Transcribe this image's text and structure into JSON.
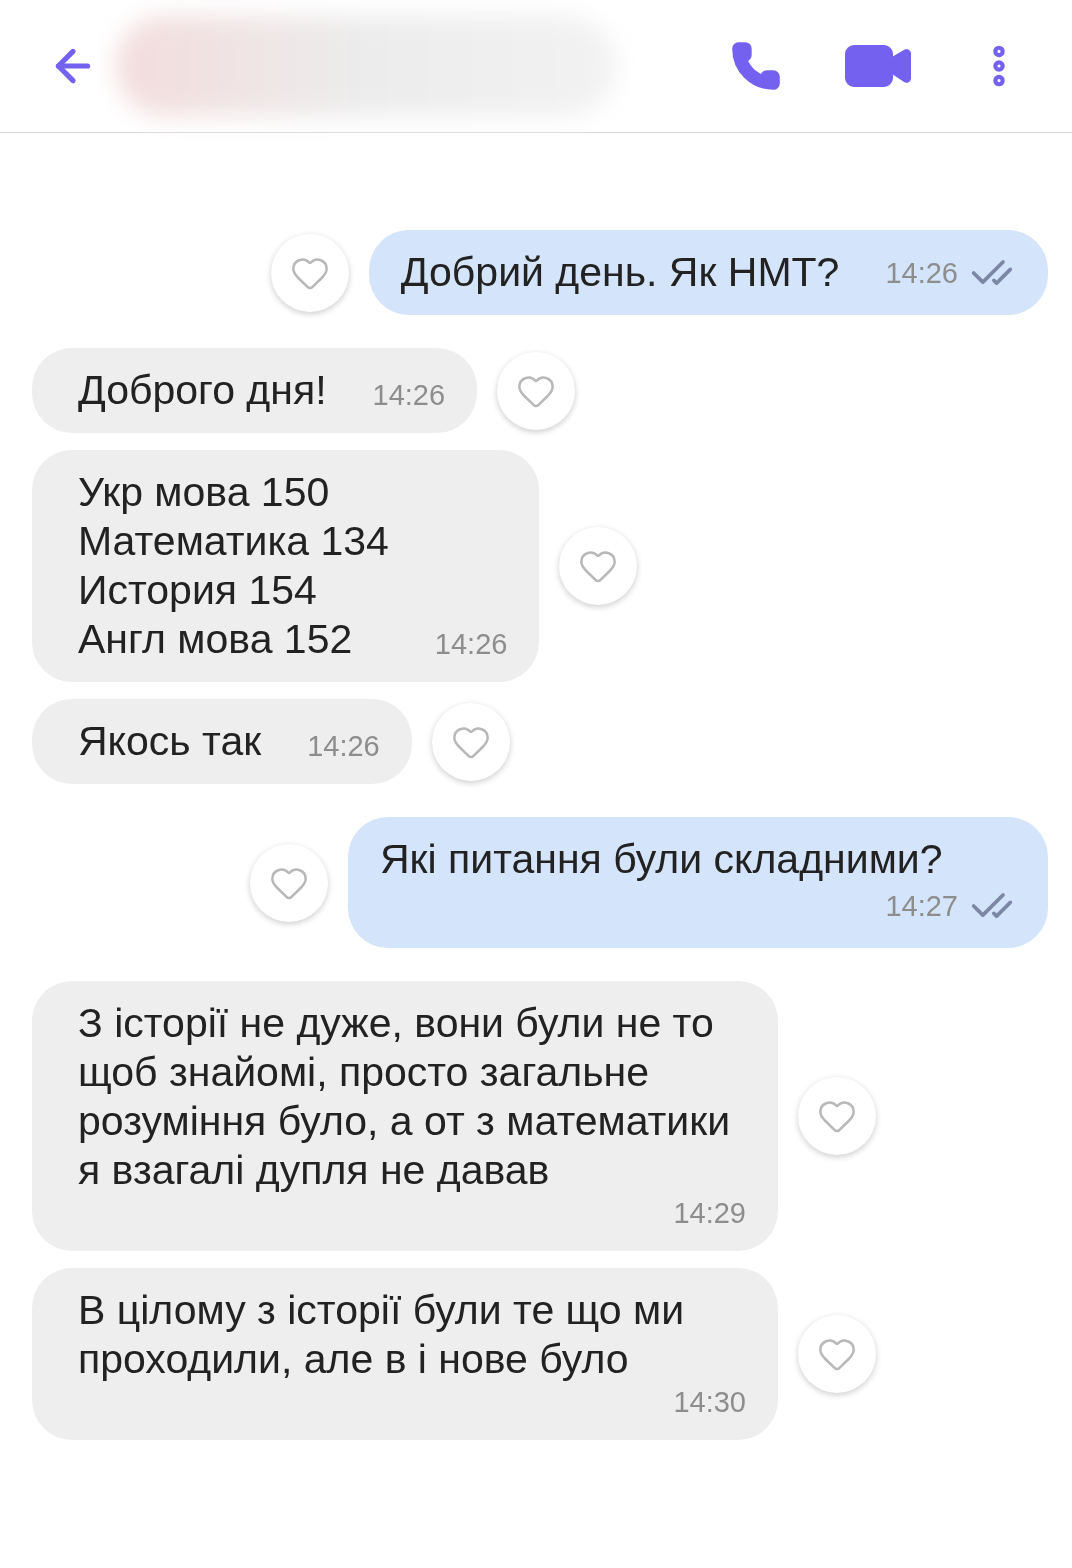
{
  "messages": [
    {
      "kind": "outgoing",
      "text": "Добрий день. Як НМТ?",
      "time": "14:26"
    },
    {
      "kind": "incoming",
      "text": "Доброго дня!",
      "time": "14:26"
    },
    {
      "kind": "incoming",
      "text": "Укр мова 150\nМатематика 134\nИстория 154\nАнгл мова 152",
      "time": "14:26"
    },
    {
      "kind": "incoming",
      "text": "Якось так",
      "time": "14:26"
    },
    {
      "kind": "outgoing",
      "text": "Які питання були складними?",
      "time": "14:27"
    },
    {
      "kind": "incoming",
      "text": "З історії не дуже, вони були не то щоб знайомі, просто загальне розуміння було, а от з математики я взагалі дупля не давав",
      "time": "14:29"
    },
    {
      "kind": "incoming",
      "text": "В цілому з історії були те що ми проходили, але в і нове було",
      "time": "14:30"
    }
  ]
}
